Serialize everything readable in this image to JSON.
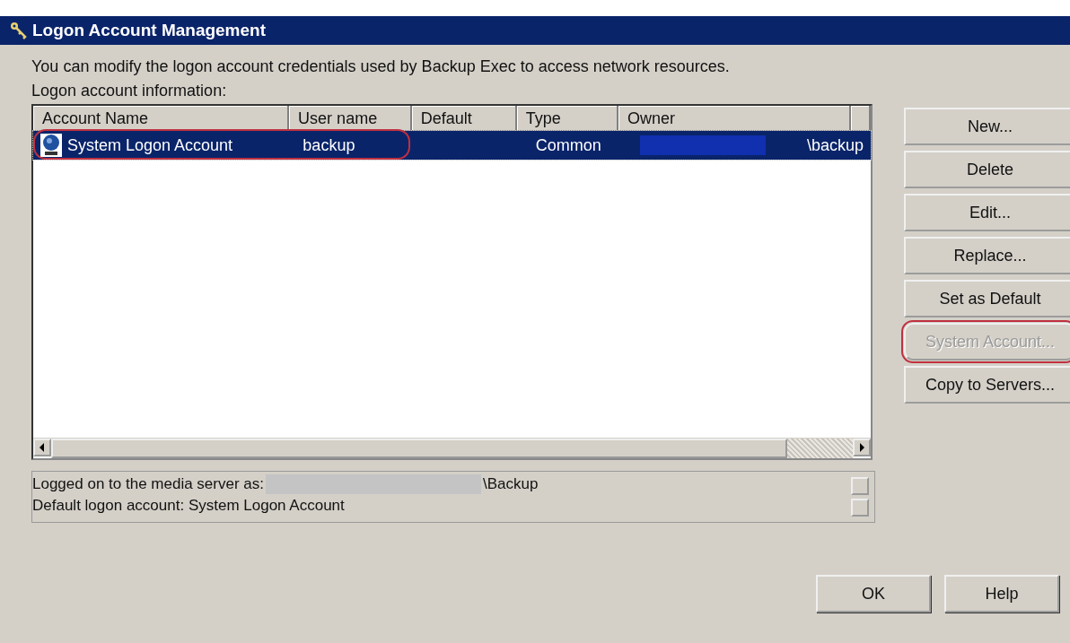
{
  "window": {
    "title": "Logon Account Management"
  },
  "description": "You can modify the logon account credentials used by Backup Exec to access network resources.",
  "list_label": "Logon account information:",
  "table": {
    "columns": [
      "Account Name",
      "User name",
      "Default",
      "Type",
      "Owner"
    ],
    "rows": [
      {
        "account_name": "System Logon Account",
        "user_name": "backup",
        "default": "",
        "type": "Common",
        "owner": "\\backup",
        "owner_redacted": true,
        "selected": true,
        "annotated": true
      }
    ]
  },
  "info": {
    "lines": [
      {
        "label": "Logged on to the media server as:",
        "value": "\\Backup",
        "redacted": true
      },
      {
        "label": "Default logon account: System Logon Account"
      }
    ]
  },
  "side_buttons": [
    {
      "label": "New...",
      "disabled": false,
      "annotated": false
    },
    {
      "label": "Delete",
      "disabled": false,
      "annotated": false
    },
    {
      "label": "Edit...",
      "disabled": false,
      "annotated": false
    },
    {
      "label": "Replace...",
      "disabled": false,
      "annotated": false
    },
    {
      "label": "Set as Default",
      "disabled": false,
      "annotated": false
    },
    {
      "label": "System Account...",
      "disabled": true,
      "annotated": true
    },
    {
      "label": "Copy to Servers...",
      "disabled": false,
      "annotated": false
    }
  ],
  "bottom_buttons": [
    "OK",
    "Help"
  ]
}
